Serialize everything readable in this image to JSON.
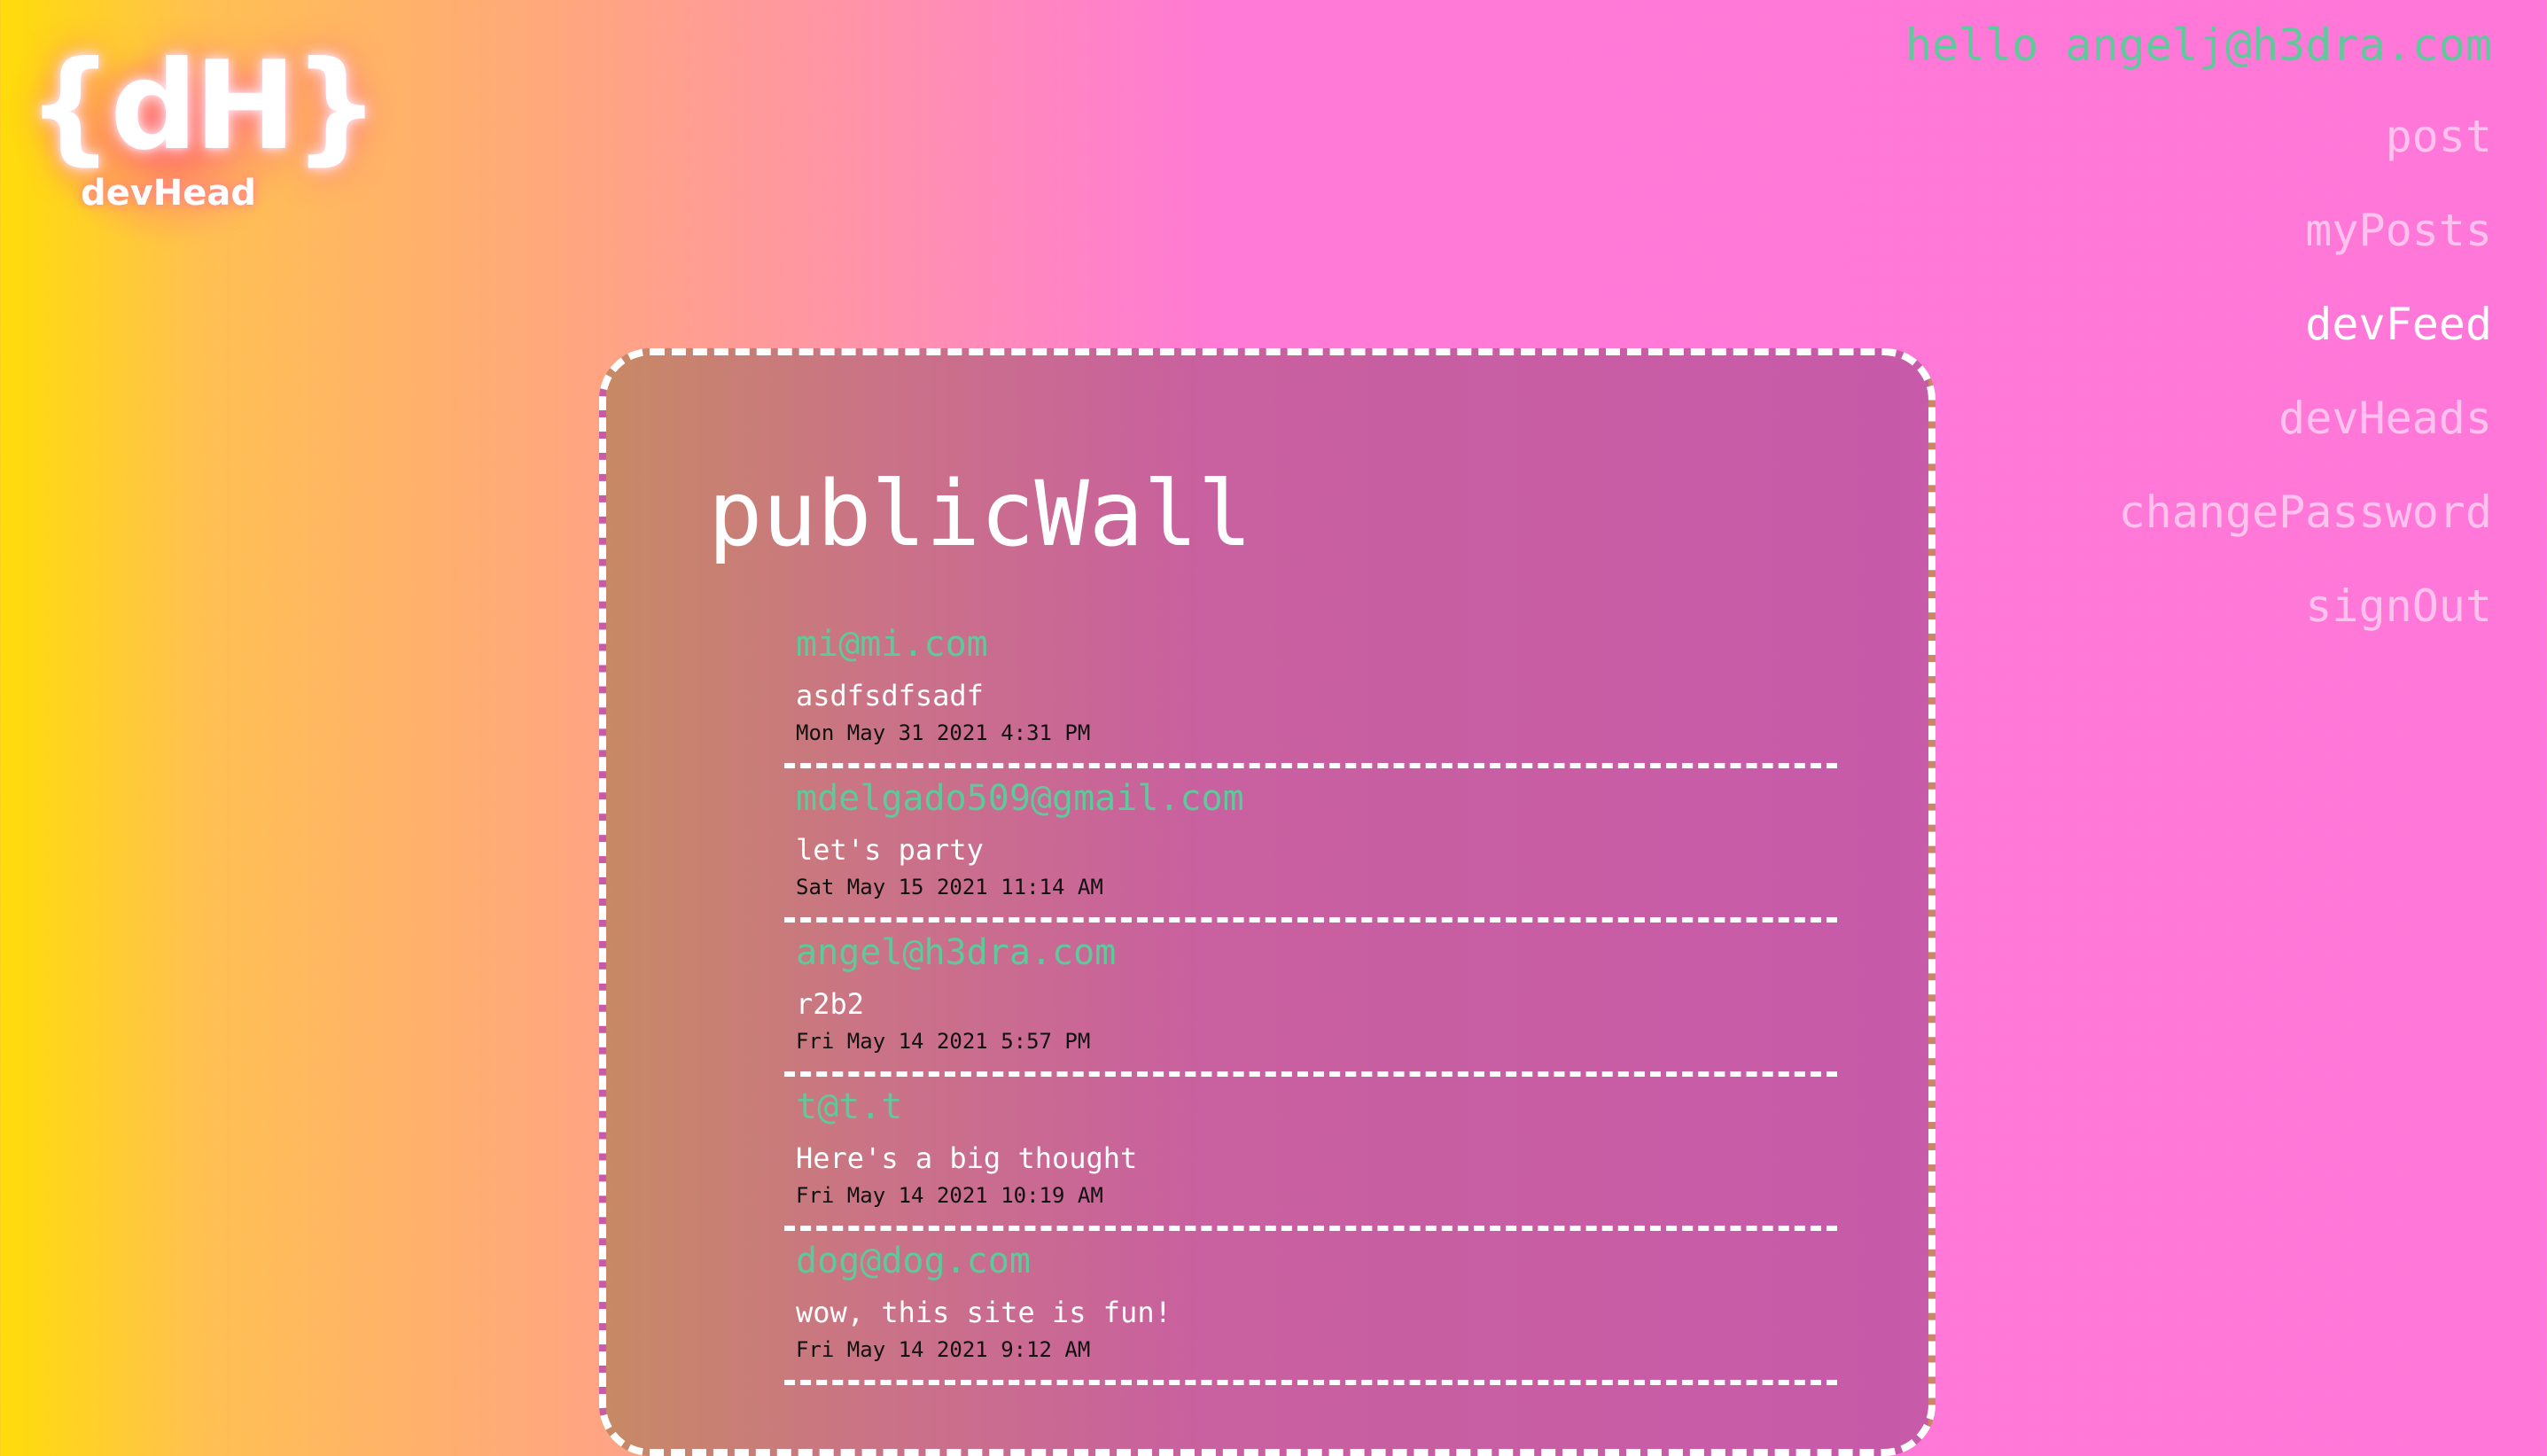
{
  "brand": {
    "mark": "{dH}",
    "name": "devHead"
  },
  "nav": {
    "greeting": "hello angelj@h3dra.com",
    "items": [
      {
        "label": "post",
        "active": false
      },
      {
        "label": "myPosts",
        "active": false
      },
      {
        "label": "devFeed",
        "active": true
      },
      {
        "label": "devHeads",
        "active": false
      },
      {
        "label": "changePassword",
        "active": false
      },
      {
        "label": "signOut",
        "active": false
      }
    ]
  },
  "wall": {
    "title": "publicWall",
    "posts": [
      {
        "author": "mi@mi.com",
        "body": "asdfsdfsadf",
        "date": "Mon May 31 2021 4:31 PM"
      },
      {
        "author": "mdelgado509@gmail.com",
        "body": "let's party",
        "date": "Sat May 15 2021 11:14 AM"
      },
      {
        "author": "angel@h3dra.com",
        "body": "r2b2",
        "date": "Fri May 14 2021 5:57 PM"
      },
      {
        "author": "t@t.t",
        "body": "Here's a big thought",
        "date": "Fri May 14 2021 10:19 AM"
      },
      {
        "author": "dog@dog.com",
        "body": "wow, this site is fun!",
        "date": "Fri May 14 2021 9:12 AM"
      }
    ]
  },
  "colors": {
    "accent_green": "#5ec99a",
    "nav_inactive": "rgba(255,255,255,0.55)",
    "nav_active": "#ffffff"
  }
}
